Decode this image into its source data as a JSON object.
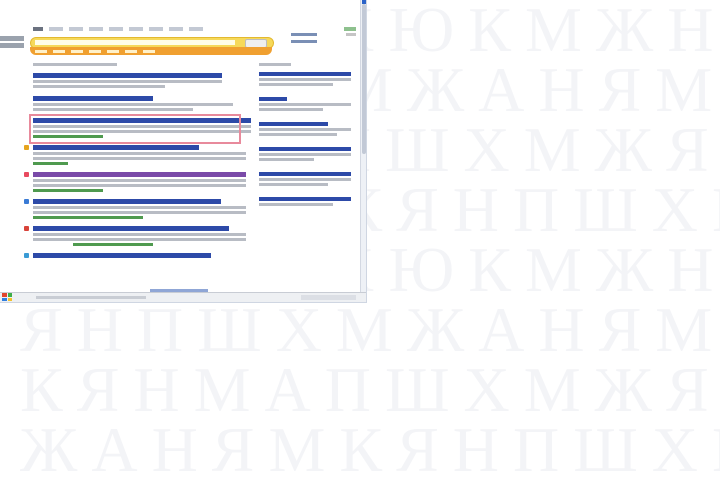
{
  "search": {
    "value": "",
    "button_label": ""
  },
  "colors": {
    "accent_bar": "#f6d95a",
    "filter_bar": "#f0a030",
    "highlight": "#e88a9c",
    "link": "#2d4aa8",
    "url": "#4f9a4f"
  },
  "icons": [
    "windows-logo-icon",
    "scroll-arrow-icon"
  ]
}
